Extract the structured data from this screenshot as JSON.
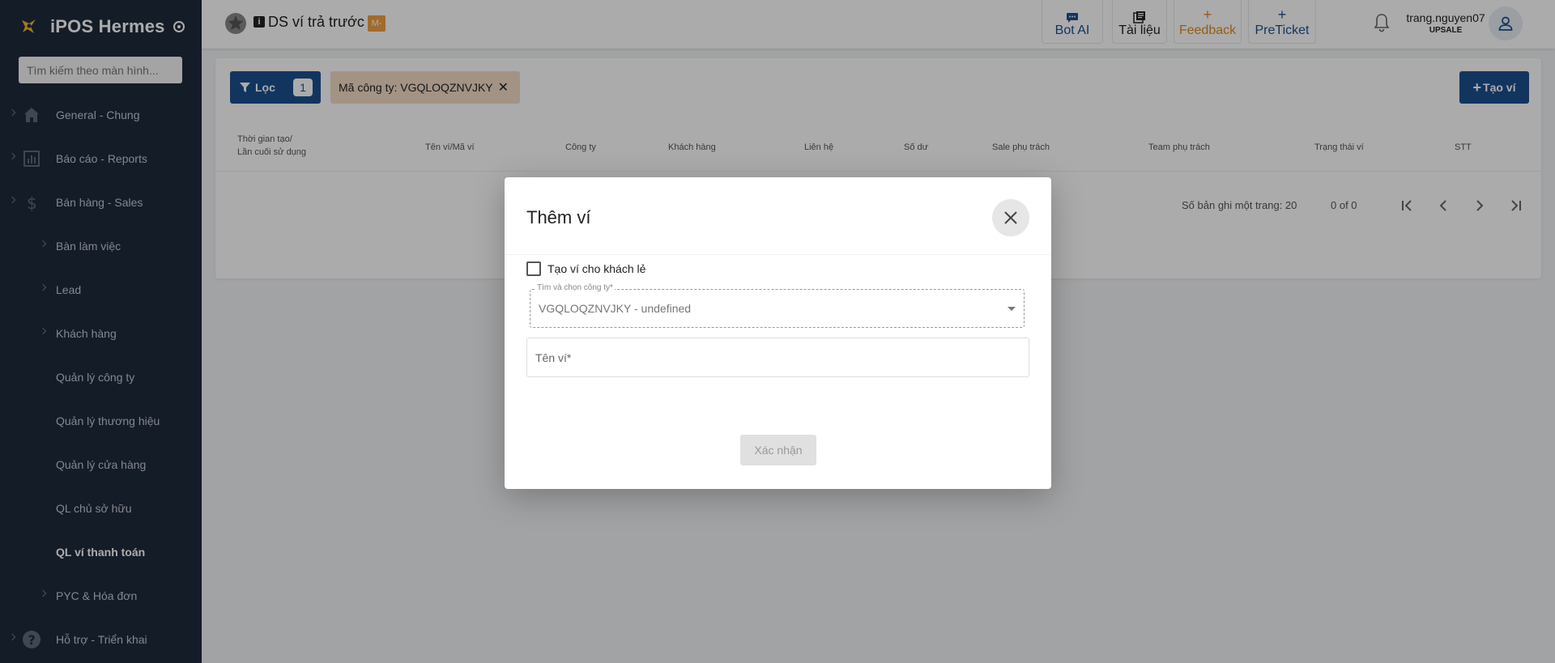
{
  "sidebar": {
    "brand": "iPOS Hermes",
    "search_placeholder": "Tìm kiếm theo màn hình...",
    "items": [
      {
        "label": "General - Chung",
        "icon": "home-icon"
      },
      {
        "label": "Báo cáo - Reports",
        "icon": "report-chart-icon"
      },
      {
        "label": "Bán hàng - Sales",
        "icon": "dollar-icon"
      },
      {
        "label": "Bàn làm việc"
      },
      {
        "label": "Lead"
      },
      {
        "label": "Khách hàng"
      },
      {
        "label": "Quản lý công ty"
      },
      {
        "label": "Quản lý thương hiệu"
      },
      {
        "label": "Quản lý cửa hàng"
      },
      {
        "label": "QL chủ sở hữu"
      },
      {
        "label": "QL ví thanh toán",
        "active": true
      },
      {
        "label": "PYC & Hóa đơn"
      },
      {
        "label": "Hỗ trợ - Triển khai",
        "icon": "help-icon"
      }
    ]
  },
  "topbar": {
    "title": "DS ví trả trước",
    "badge": "M-",
    "buttons": {
      "bot_ai": "Bot AI",
      "tai_lieu": "Tài liệu",
      "feedback": "Feedback",
      "preticket": "PreTicket"
    },
    "username": "trang.nguyen07",
    "role": "UPSALE"
  },
  "content": {
    "filter_label": "Lọc",
    "filter_count": "1",
    "chip_label": "Mã công ty: VGQLOQZNVJKY",
    "create_label": "Tạo ví",
    "columns": [
      "Thời gian tạo/",
      "Lần cuối sử dụng",
      "Tên ví/Mã ví",
      "Công ty",
      "Khách hàng",
      "Liên hệ",
      "Số dư",
      "Sale phụ trách",
      "Team phụ trách",
      "Trạng thái ví",
      "STT"
    ],
    "pager": {
      "rows_per_page": "Số bản ghi một trang: 20",
      "range": "0 of 0"
    }
  },
  "modal": {
    "title": "Thêm ví",
    "checkbox_label": "Tạo ví cho khách lẻ",
    "company_label": "Tìm và chọn công ty*",
    "company_value": "VGQLOQZNVJKY - undefined",
    "wallet_name_placeholder": "Tên ví*",
    "confirm": "Xác nhận"
  },
  "colors": {
    "primary": "#1b4f8f",
    "sidebar_bg": "#1e2a3d",
    "feedback": "#e08a1e",
    "chip_bg": "#f3dcc6"
  }
}
